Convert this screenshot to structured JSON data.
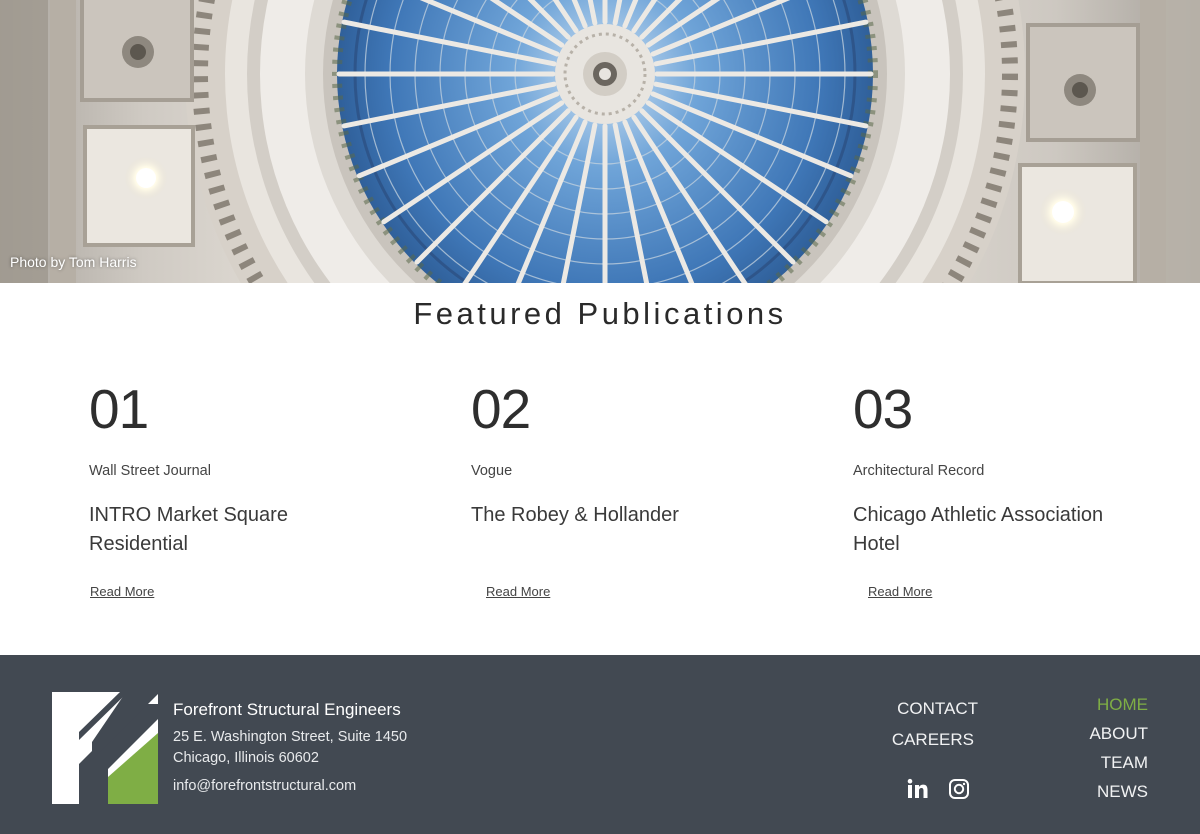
{
  "hero": {
    "photo_credit": "Photo by Tom Harris"
  },
  "publications": {
    "heading": "Featured Publications",
    "items": [
      {
        "number": "01",
        "source": "Wall Street Journal",
        "title": "INTRO Market Square Residential",
        "link": "Read More"
      },
      {
        "number": "02",
        "source": "Vogue",
        "title": "The Robey & Hollander",
        "link": "Read More"
      },
      {
        "number": "03",
        "source": "Architectural Record",
        "title": "Chicago Athletic Association Hotel",
        "link": "Read More"
      }
    ]
  },
  "footer": {
    "company": "Forefront Structural Engineers",
    "address_line1": "25 E. Washington Street, Suite 1450",
    "address_line2": "Chicago, Illinois 60602",
    "email": "info@forefrontstructural.com",
    "links_left": [
      "CONTACT",
      "CAREERS"
    ],
    "links_right": [
      "HOME",
      "ABOUT",
      "TEAM",
      "NEWS"
    ],
    "active_link": "HOME",
    "social": [
      "linkedin-icon",
      "instagram-icon"
    ]
  },
  "colors": {
    "footer_bg": "#424952",
    "accent_green": "#7fae45",
    "glass_blue": "#4d86c2"
  }
}
